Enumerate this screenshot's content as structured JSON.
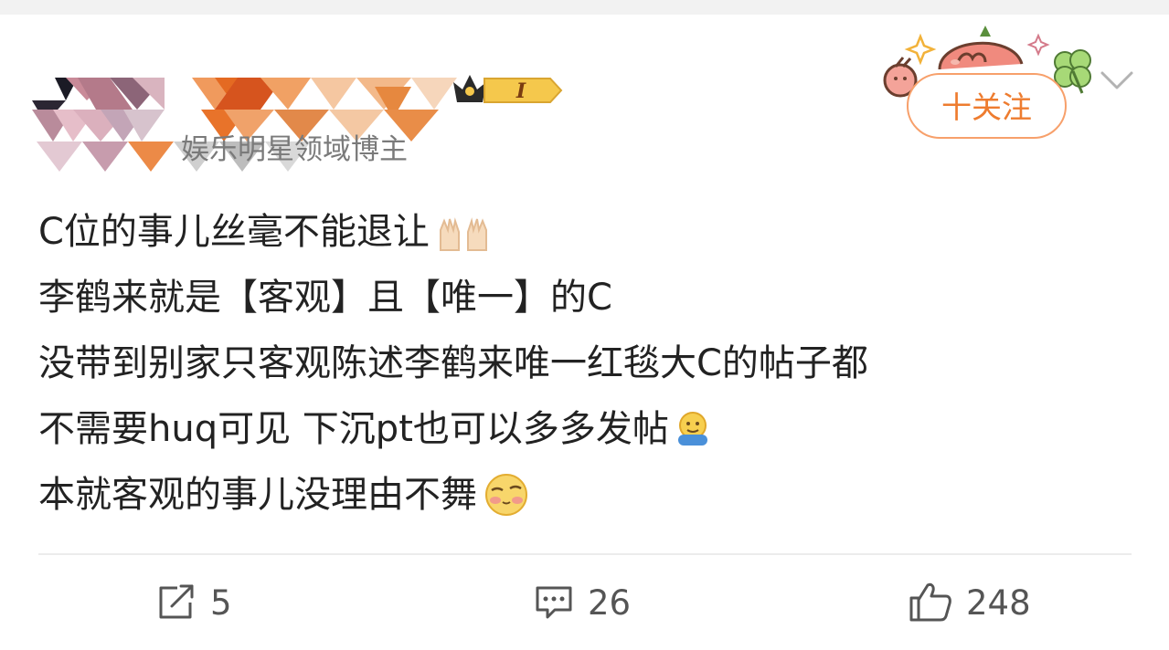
{
  "post": {
    "verification": "娱乐明星领域博主",
    "badge_label": "I",
    "follow_label": "十关注",
    "lines": [
      "C位的事儿丝毫不能退让",
      "李鹤来就是【客观】且【唯一】的C",
      "没带到别家只客观陈述李鹤来唯一红毯大C的帖子都",
      "不需要huq可见 下沉pt也可以多多发帖",
      "本就客观的事儿没理由不舞"
    ],
    "line_emojis": [
      "raised-hands-emoji",
      "",
      "",
      "hug-emoji",
      "shy-smile-emoji"
    ]
  },
  "actions": {
    "repost_count": "5",
    "comment_count": "26",
    "like_count": "248"
  },
  "icons": {
    "repost": "repost-icon",
    "comment": "comment-icon",
    "like": "thumbs-up-icon",
    "more": "chevron-down-icon"
  },
  "colors": {
    "follow_accent": "#ee7c2f",
    "follow_border": "#f7a06b",
    "text": "#222222",
    "muted": "#7a7a7a",
    "icon_gray": "#555555",
    "badge_gold": "#f5c84c"
  }
}
